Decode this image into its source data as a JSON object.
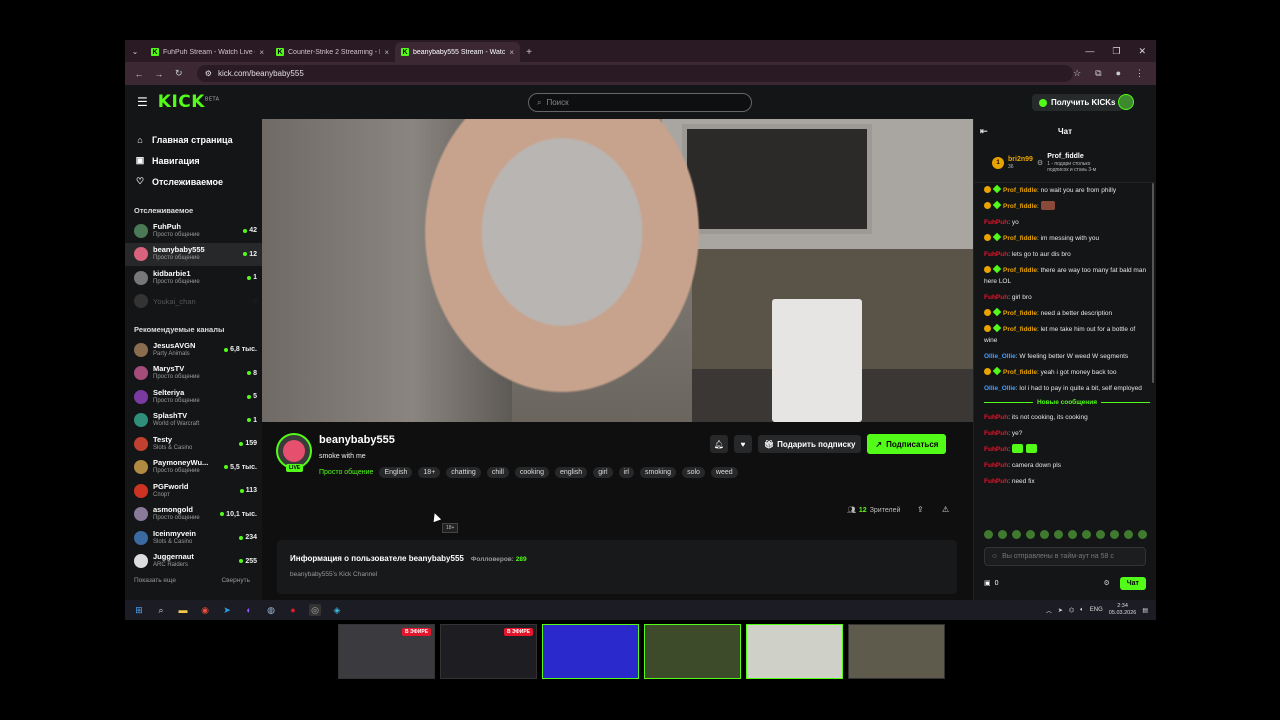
{
  "browser": {
    "tabs": [
      {
        "title": "FuhPuh Stream - Watch Live o",
        "active": false
      },
      {
        "title": "Counter-Strike 2 Streaming - L",
        "active": false
      },
      {
        "title": "beanybaby555 Stream - Watc",
        "active": true
      }
    ],
    "url": "kick.com/beanybaby555"
  },
  "header": {
    "logo": "KICK",
    "logo_badge": "BETA",
    "search_placeholder": "Поиск",
    "get_kicks": "Получить KICKs"
  },
  "sidebar": {
    "nav": [
      {
        "label": "Главная страница",
        "icon": "home-icon"
      },
      {
        "label": "Навигация",
        "icon": "browse-icon"
      },
      {
        "label": "Отслеживаемое",
        "icon": "heart-icon"
      }
    ],
    "following_title": "Отслеживаемое",
    "following": [
      {
        "name": "FuhPuh",
        "category": "Просто общение",
        "viewers": "42",
        "active": false,
        "online": true
      },
      {
        "name": "beanybaby555",
        "category": "Просто общение",
        "viewers": "12",
        "active": true,
        "online": true
      },
      {
        "name": "kidbarbie1",
        "category": "Просто общение",
        "viewers": "1",
        "active": false,
        "online": true
      },
      {
        "name": "Youkai_chan",
        "category": "",
        "viewers": "",
        "active": false,
        "online": false
      }
    ],
    "recommended_title": "Рекомендуемые каналы",
    "recommended": [
      {
        "name": "JesusAVGN",
        "category": "Party Animals",
        "viewers": "6,8 тыс."
      },
      {
        "name": "MarysTV",
        "category": "Просто общение",
        "viewers": "8"
      },
      {
        "name": "Selteriya",
        "category": "Просто общение",
        "viewers": "5"
      },
      {
        "name": "SplashTV",
        "category": "World of Warcraft",
        "viewers": "1"
      },
      {
        "name": "Testy",
        "category": "Slots & Casino",
        "viewers": "159"
      },
      {
        "name": "PaymoneyWu...",
        "category": "Просто общение",
        "viewers": "5,5 тыс."
      },
      {
        "name": "PGFworld",
        "category": "Спорт",
        "viewers": "113"
      },
      {
        "name": "asmongold",
        "category": "Просто общение",
        "viewers": "10,1 тыс."
      },
      {
        "name": "Iceinmyvein",
        "category": "Slots & Casino",
        "viewers": "234"
      },
      {
        "name": "Juggernaut",
        "category": "ARC Raiders",
        "viewers": "255"
      }
    ],
    "show_more": "Показать еще",
    "collapse": "Свернуть"
  },
  "stream": {
    "streamer": "beanybaby555",
    "title": "smoke with me",
    "category": "Просто общение",
    "live_label": "LIVE",
    "tags": [
      "English",
      "18+",
      "chatting",
      "chill",
      "cooking",
      "english",
      "girl",
      "irl",
      "smoking",
      "solo",
      "weed"
    ],
    "tooltip": "18+",
    "gift_sub": "Подарить подписку",
    "follow": "Подписаться",
    "viewers_count": "12",
    "viewers_label": "Зрителей",
    "about_title": "Информация о пользователе beanybaby555",
    "followers_label": "Фолловеров:",
    "followers_count": "289",
    "about_desc": "beanybaby555's Kick Channel"
  },
  "chat": {
    "title": "Чат",
    "pinned": {
      "sender": "bri2n99",
      "count": "36",
      "gifter_label": "1",
      "recipient": "Prof_fiddle",
      "line1": "1 - подари столько",
      "line2": "подписок и стань 3-м"
    },
    "messages": [
      {
        "user": "Prof_fiddle",
        "color": "#e8a300",
        "badges": true,
        "text": "no wait you are from philly"
      },
      {
        "user": "Prof_fiddle",
        "color": "#e8a300",
        "badges": true,
        "text": "",
        "emote": "brown"
      },
      {
        "user": "FuhPuh",
        "color": "#e5162c",
        "badges": false,
        "text": "yo"
      },
      {
        "user": "Prof_fiddle",
        "color": "#e8a300",
        "badges": true,
        "text": "im messing with you"
      },
      {
        "user": "FuhPuh",
        "color": "#e5162c",
        "badges": false,
        "text": "lets go to aur dis bro"
      },
      {
        "user": "Prof_fiddle",
        "color": "#e8a300",
        "badges": true,
        "text": "there are way too many fat bald man here LOL"
      },
      {
        "user": "FuhPuh",
        "color": "#e5162c",
        "badges": false,
        "text": "girl bro"
      },
      {
        "user": "Prof_fiddle",
        "color": "#e8a300",
        "badges": true,
        "text": "need a better description"
      },
      {
        "user": "Prof_fiddle",
        "color": "#e8a300",
        "badges": true,
        "text": "let me take him out for a bottle of wine"
      },
      {
        "user": "Ollie_Ollie",
        "color": "#4a9eff",
        "badges": false,
        "text": "W feeling better W weed W segments"
      },
      {
        "user": "Prof_fiddle",
        "color": "#e8a300",
        "badges": true,
        "text": "yeah i got money back too"
      },
      {
        "user": "Ollie_Ollie",
        "color": "#4a9eff",
        "badges": false,
        "text": "lol i had to pay in quite a bit, self employed"
      }
    ],
    "new_messages": "Новые сообщения",
    "new": [
      {
        "user": "FuhPuh",
        "text": "its not cooking, its cooking"
      },
      {
        "user": "FuhPuh",
        "text": "ye?"
      },
      {
        "user": "FuhPuh",
        "text": "",
        "emote": "green"
      },
      {
        "user": "FuhPuh",
        "text": "camera down pls"
      },
      {
        "user": "FuhPuh",
        "text": "need fix"
      }
    ],
    "input_placeholder": "Вы отправлены в тайм-аут на 58 с",
    "points": "0",
    "send": "Чат"
  },
  "taskbar": {
    "lang": "ENG",
    "time": "2:34",
    "date": "05.03.2026"
  },
  "thumbnails": [
    {
      "badge": "В ЭФИРЕ",
      "color": "#3a3a3f"
    },
    {
      "badge": "В ЭФИРЕ",
      "color": "#1e1e22"
    },
    {
      "badge": "",
      "color": "#2a2acc"
    },
    {
      "badge": "",
      "color": "#3e4b2a"
    },
    {
      "badge": "",
      "color": "#cfd0c8"
    },
    {
      "badge": "",
      "color": "#5f5b4c"
    }
  ]
}
